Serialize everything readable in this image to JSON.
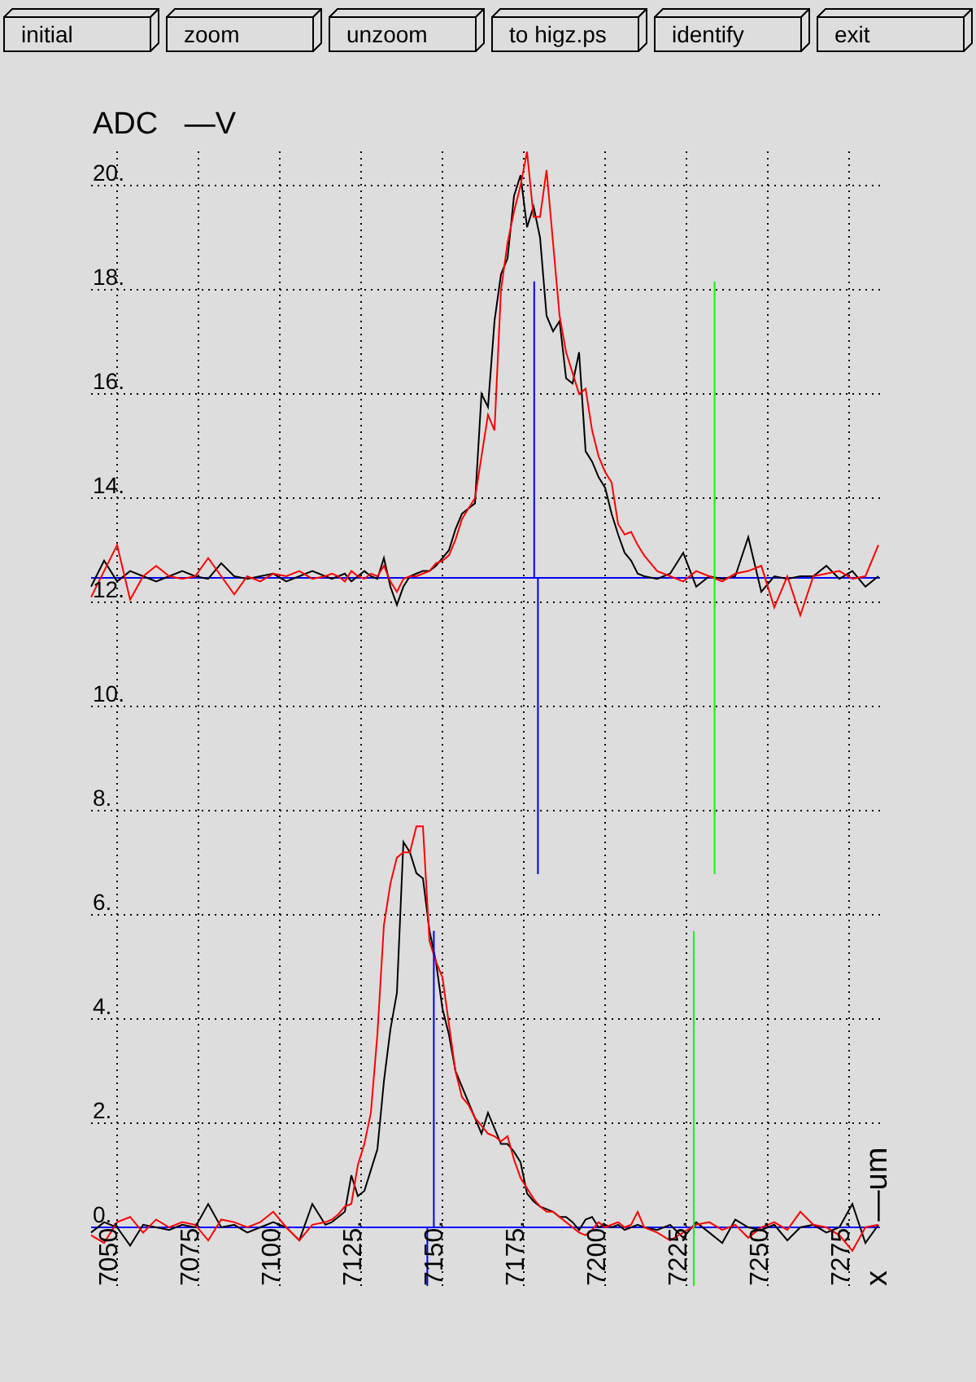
{
  "toolbar": {
    "buttons": [
      "initial",
      "zoom",
      "unzoom",
      "to higz.ps",
      "identify",
      "exit"
    ]
  },
  "plot": {
    "x_axis_label": "x —um",
    "chart_data": {
      "type": "line",
      "ylabel": "ADC —V",
      "grid": true,
      "x": [
        7042,
        7046,
        7050,
        7054,
        7058,
        7062,
        7066,
        7070,
        7074,
        7078,
        7082,
        7086,
        7090,
        7094,
        7098,
        7102,
        7106,
        7110,
        7114,
        7116,
        7118,
        7120,
        7122,
        7124,
        7126,
        7128,
        7130,
        7132,
        7134,
        7136,
        7138,
        7140,
        7142,
        7144,
        7146,
        7148,
        7150,
        7152,
        7154,
        7156,
        7158,
        7160,
        7162,
        7164,
        7166,
        7168,
        7170,
        7172,
        7174,
        7176,
        7178,
        7180,
        7182,
        7184,
        7186,
        7188,
        7190,
        7192,
        7194,
        7196,
        7198,
        7200,
        7202,
        7204,
        7206,
        7208,
        7210,
        7212,
        7216,
        7220,
        7224,
        7228,
        7232,
        7236,
        7240,
        7244,
        7248,
        7252,
        7256,
        7260,
        7264,
        7268,
        7272,
        7276,
        7280,
        7284
      ],
      "series": [
        {
          "color": "#000000",
          "values": [
            12.3,
            12.8,
            12.4,
            12.6,
            12.5,
            12.4,
            12.5,
            12.6,
            12.5,
            12.45,
            12.75,
            12.5,
            12.45,
            12.5,
            12.55,
            12.4,
            12.5,
            12.6,
            12.5,
            12.45,
            12.5,
            12.55,
            12.4,
            12.5,
            12.6,
            12.5,
            12.45,
            12.85,
            12.3,
            11.95,
            12.3,
            12.5,
            12.55,
            12.6,
            12.6,
            12.7,
            12.85,
            13.0,
            13.4,
            13.7,
            13.8,
            13.9,
            16.0,
            15.75,
            17.4,
            18.3,
            18.6,
            19.8,
            20.2,
            19.2,
            19.6,
            19.0,
            17.5,
            17.2,
            17.4,
            16.3,
            16.2,
            16.8,
            14.9,
            14.7,
            14.4,
            14.2,
            13.7,
            13.3,
            12.95,
            12.8,
            12.55,
            12.5,
            12.45,
            12.55,
            12.95,
            12.3,
            12.5,
            12.45,
            12.5,
            13.25,
            12.2,
            12.5,
            12.45,
            12.5,
            12.5,
            12.7,
            12.45,
            12.6,
            12.3,
            12.5
          ]
        },
        {
          "color": "#ff0000",
          "values": [
            12.1,
            12.6,
            13.1,
            12.05,
            12.5,
            12.7,
            12.5,
            12.45,
            12.5,
            12.85,
            12.5,
            12.15,
            12.5,
            12.4,
            12.55,
            12.5,
            12.6,
            12.45,
            12.5,
            12.55,
            12.5,
            12.4,
            12.6,
            12.5,
            12.45,
            12.55,
            12.5,
            12.7,
            12.4,
            12.2,
            12.45,
            12.5,
            12.5,
            12.55,
            12.6,
            12.75,
            12.8,
            12.9,
            13.2,
            13.6,
            13.8,
            14.0,
            14.8,
            15.6,
            15.3,
            18.0,
            18.9,
            19.5,
            20.0,
            20.65,
            19.4,
            19.4,
            20.3,
            18.9,
            17.5,
            16.8,
            16.4,
            16.0,
            16.1,
            15.3,
            14.8,
            14.5,
            14.3,
            13.5,
            13.3,
            13.35,
            13.1,
            12.9,
            12.6,
            12.5,
            12.4,
            12.6,
            12.5,
            12.4,
            12.55,
            12.6,
            12.7,
            11.9,
            12.5,
            11.75,
            12.5,
            12.55,
            12.6,
            12.45,
            12.5,
            13.1
          ]
        },
        {
          "color": "#000000",
          "values": [
            -0.1,
            0.1,
            0.0,
            -0.35,
            0.05,
            0.0,
            -0.05,
            0.05,
            0.0,
            0.45,
            0.0,
            0.05,
            -0.1,
            0.0,
            0.1,
            0.0,
            -0.25,
            0.45,
            0.05,
            0.1,
            0.2,
            0.3,
            1.0,
            0.6,
            0.7,
            1.1,
            1.5,
            2.8,
            3.8,
            4.5,
            7.4,
            7.2,
            6.8,
            6.7,
            5.7,
            5.1,
            4.2,
            3.7,
            3.0,
            2.7,
            2.4,
            2.1,
            1.8,
            2.2,
            1.9,
            1.6,
            1.6,
            1.45,
            1.25,
            0.65,
            0.5,
            0.4,
            0.35,
            0.3,
            0.2,
            0.2,
            0.1,
            -0.05,
            0.15,
            0.2,
            0.0,
            0.05,
            0.0,
            0.05,
            -0.05,
            0.0,
            0.05,
            0.0,
            -0.05,
            0.05,
            -0.2,
            0.1,
            -0.1,
            -0.3,
            0.15,
            0.0,
            -0.05,
            0.05,
            -0.25,
            0.0,
            0.05,
            -0.1,
            0.0,
            0.45,
            -0.3,
            0.05
          ]
        },
        {
          "color": "#ff0000",
          "values": [
            -0.15,
            -0.3,
            0.1,
            0.2,
            -0.1,
            0.15,
            0.0,
            0.1,
            0.05,
            -0.25,
            0.15,
            0.1,
            0.0,
            0.1,
            0.3,
            0.0,
            -0.25,
            0.05,
            0.1,
            0.15,
            0.25,
            0.4,
            0.45,
            1.2,
            1.6,
            2.2,
            3.7,
            5.8,
            6.6,
            7.1,
            7.2,
            7.2,
            7.7,
            7.7,
            5.5,
            5.1,
            4.8,
            3.9,
            3.0,
            2.5,
            2.35,
            2.1,
            1.95,
            1.8,
            1.75,
            1.65,
            1.75,
            1.3,
            0.95,
            0.75,
            0.55,
            0.4,
            0.3,
            0.3,
            0.2,
            0.1,
            0.0,
            -0.1,
            -0.15,
            -0.05,
            0.1,
            0.0,
            0.05,
            0.1,
            0.0,
            0.05,
            0.3,
            0.0,
            -0.1,
            -0.25,
            -0.1,
            0.05,
            0.1,
            -0.05,
            0.05,
            -0.2,
            0.0,
            0.1,
            -0.05,
            0.3,
            0.05,
            0.0,
            -0.15,
            -0.45,
            0.0,
            0.05
          ]
        }
      ],
      "xlim": [
        7042,
        7284.5
      ],
      "ylim": [
        -1.125,
        20.65625
      ],
      "xticks": [
        {
          "value": 7050,
          "label": "7050."
        },
        {
          "value": 7075,
          "label": "7075."
        },
        {
          "value": 7100,
          "label": "7100."
        },
        {
          "value": 7125,
          "label": "7125."
        },
        {
          "value": 7150,
          "label": "7150."
        },
        {
          "value": 7175,
          "label": "7175."
        },
        {
          "value": 7200,
          "label": "7200."
        },
        {
          "value": 7225,
          "label": "7225."
        },
        {
          "value": 7250,
          "label": "7250."
        },
        {
          "value": 7275,
          "label": "7275."
        }
      ],
      "yticks": [
        {
          "value": 0,
          "label": "0."
        },
        {
          "value": 2,
          "label": "2."
        },
        {
          "value": 4,
          "label": "4."
        },
        {
          "value": 6,
          "label": "6."
        },
        {
          "value": 8,
          "label": "8."
        },
        {
          "value": 10,
          "label": "10."
        },
        {
          "value": 12,
          "label": "12."
        },
        {
          "value": 14,
          "label": "14."
        },
        {
          "value": 16,
          "label": "16."
        },
        {
          "value": 18,
          "label": "18."
        },
        {
          "value": 20,
          "label": "20."
        }
      ],
      "ref_lines": [
        {
          "axis": "y",
          "value": 12.47,
          "color": "#0000ff"
        },
        {
          "axis": "y",
          "value": 0,
          "color": "#0000ff"
        }
      ]
    }
  }
}
